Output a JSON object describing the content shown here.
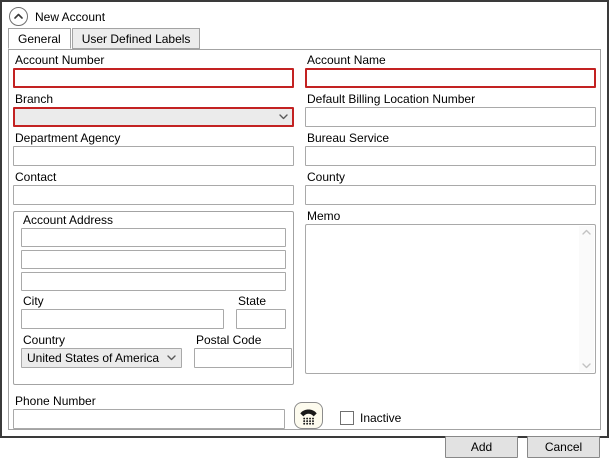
{
  "window": {
    "title": "New Account"
  },
  "tabs": [
    {
      "label": "General",
      "active": true
    },
    {
      "label": "User Defined Labels",
      "active": false
    }
  ],
  "fields": {
    "account_number": {
      "label": "Account Number",
      "value": "",
      "error": true
    },
    "account_name": {
      "label": "Account Name",
      "value": "",
      "error": true
    },
    "branch": {
      "label": "Branch",
      "value": "",
      "error": true
    },
    "default_billing_location_number": {
      "label": "Default Billing Location Number",
      "value": ""
    },
    "department_agency": {
      "label": "Department Agency",
      "value": ""
    },
    "bureau_service": {
      "label": "Bureau Service",
      "value": ""
    },
    "contact": {
      "label": "Contact",
      "value": ""
    },
    "county": {
      "label": "County",
      "value": ""
    },
    "memo": {
      "label": "Memo",
      "value": ""
    },
    "address": {
      "group_label": "Account Address",
      "line1": "",
      "line2": "",
      "line3": "",
      "city": {
        "label": "City",
        "value": ""
      },
      "state": {
        "label": "State",
        "value": ""
      },
      "country": {
        "label": "Country",
        "value": "United States of America"
      },
      "postal_code": {
        "label": "Postal Code",
        "value": ""
      }
    },
    "phone": {
      "label": "Phone Number",
      "value": ""
    },
    "inactive": {
      "label": "Inactive",
      "checked": false
    }
  },
  "icons": {
    "collapse": "chevron-up-icon",
    "combo": "chevron-down-icon",
    "phone": "telephone-icon"
  },
  "buttons": {
    "add": "Add",
    "cancel": "Cancel"
  },
  "colors": {
    "error_border": "#c32222",
    "control_border": "#a9a9a9",
    "window_border": "#3a3a3a",
    "button_bg": "#e2e2e2",
    "tab_inactive_bg": "#ececec",
    "combo_bg": "#ebebeb",
    "phone_button_bg": "#fdfbee"
  }
}
